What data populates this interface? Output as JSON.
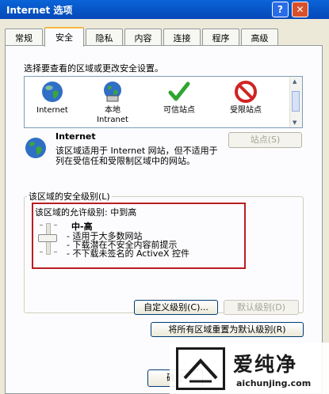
{
  "window": {
    "title": "Internet 选项",
    "help_glyph": "?",
    "close_glyph": "✕"
  },
  "tabs": [
    {
      "label": "常规",
      "active": false
    },
    {
      "label": "安全",
      "active": true
    },
    {
      "label": "隐私",
      "active": false
    },
    {
      "label": "内容",
      "active": false
    },
    {
      "label": "连接",
      "active": false
    },
    {
      "label": "程序",
      "active": false
    },
    {
      "label": "高级",
      "active": false
    }
  ],
  "zone_select_label": "选择要查看的区域或更改安全设置。",
  "zones": [
    {
      "label": "Internet",
      "icon": "globe-icon"
    },
    {
      "label": "本地\nIntranet",
      "icon": "network-computer-icon"
    },
    {
      "label": "可信站点",
      "icon": "checkmark-icon"
    },
    {
      "label": "受限站点",
      "icon": "restricted-icon"
    }
  ],
  "zone_info": {
    "title": "Internet",
    "description": "该区域适用于 Internet 网站，但不适用于列在受信任和受限制区域中的网站。",
    "sites_button": "站点(S)"
  },
  "security_level": {
    "group_label": "该区域的安全级别(L)",
    "allowed_levels": "该区域的允许级别: 中到高",
    "level_name": "中-高",
    "descriptions": [
      "- 适用于大多数网站",
      "- 下载潜在不安全内容前提示",
      "- 不下载未签名的 ActiveX 控件"
    ],
    "custom_button": "自定义级别(C)...",
    "default_button": "默认级别(D)"
  },
  "reset_button": "将所有区域重置为默认级别(R)",
  "ok_button": "确定",
  "watermark": {
    "text": "爱纯净",
    "url": "aichunjing.com"
  },
  "colors": {
    "titlebar": "#0a64d8",
    "highlight_box": "#b81d22",
    "active_tab_accent": "#f9b73d"
  }
}
